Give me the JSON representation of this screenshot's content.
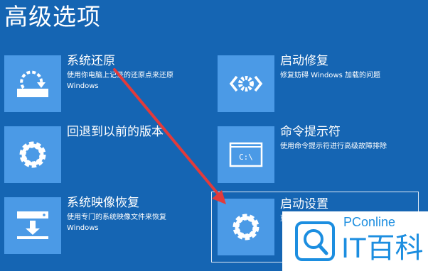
{
  "page": {
    "title": "高级选项"
  },
  "options": {
    "system_restore": {
      "title": "系统还原",
      "desc_line1": "使用你电脑上记录的还原点来还原",
      "desc_line2": "Windows"
    },
    "startup_repair": {
      "title": "启动修复",
      "desc_line1": "修复妨碍 Windows 加载的问题",
      "desc_line2": ""
    },
    "go_back": {
      "title": "回退到以前的版本",
      "desc_line1": "",
      "desc_line2": ""
    },
    "command_prompt": {
      "title": "命令提示符",
      "desc_line1": "使用命令提示符进行高级故障排除",
      "desc_line2": "",
      "icon_text": "C:\\"
    },
    "image_recovery": {
      "title": "系统映像恢复",
      "desc_line1": "使用专门的系统映像文件来恢复",
      "desc_line2": "Windows"
    },
    "startup_settings": {
      "title": "启动设置",
      "desc_line1": "更",
      "desc_line2": ""
    }
  },
  "watermark": {
    "brand": "PConline",
    "name": "IT百科"
  },
  "colors": {
    "background": "#1565b3",
    "tile_icon": "#4b9ae6",
    "arrow": "#e23b3b",
    "watermark": "#1c8ee0"
  }
}
